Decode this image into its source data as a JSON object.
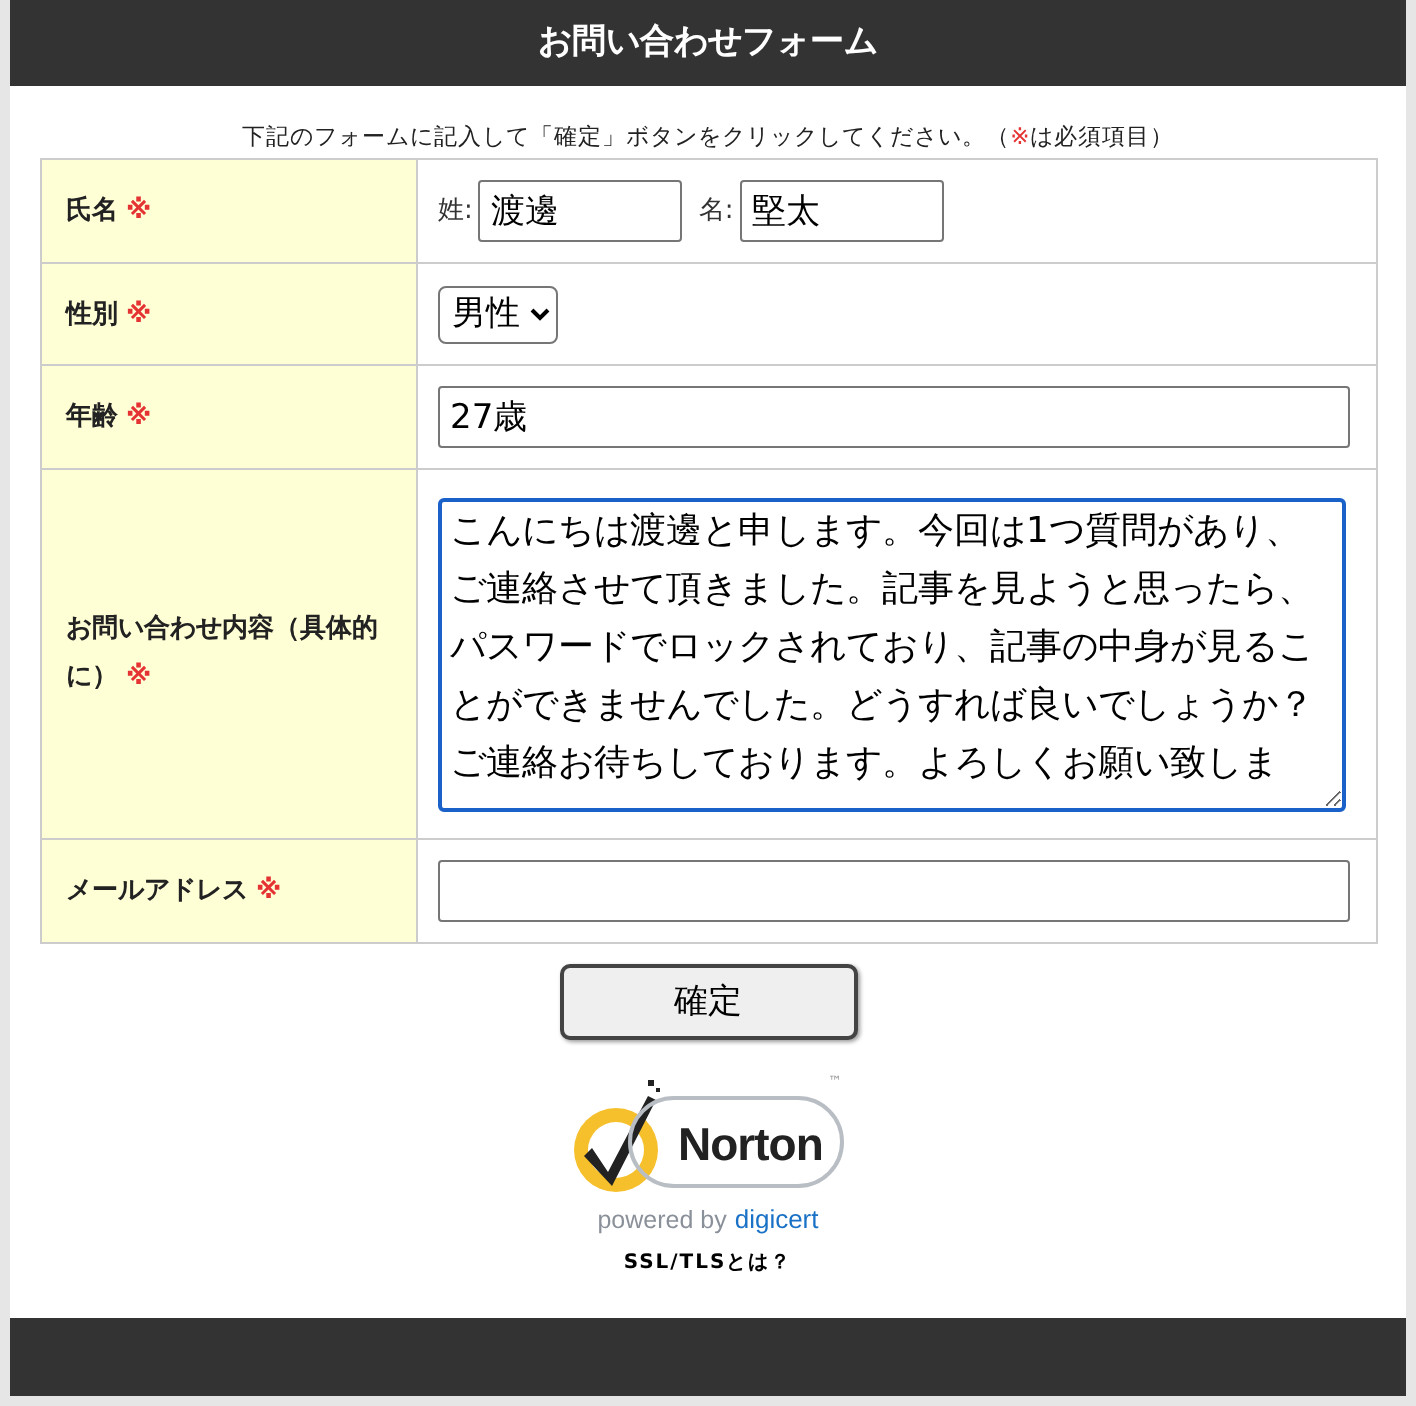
{
  "header": {
    "title": "お問い合わせフォーム"
  },
  "instruction": {
    "before": "下記のフォームに記入して「確定」ボタンをクリックしてください。（",
    "mark": "※",
    "after": "は必須項目）"
  },
  "rows": [
    {
      "kind": "name",
      "label": "氏名",
      "mark": "※",
      "last_label": "姓:",
      "last_value": "渡邊",
      "first_label": "名:",
      "first_value": "堅太"
    },
    {
      "kind": "select",
      "label": "性別",
      "mark": "※",
      "value": "男性"
    },
    {
      "kind": "text",
      "label": "年齢",
      "mark": "※",
      "value": "27歳"
    },
    {
      "kind": "textarea",
      "label": "お問い合わせ内容（具体的に）",
      "mark": "※",
      "focused": true,
      "value": "こんにちは渡邊と申します。今回は1つ質問があり、ご連絡させて頂きました。記事を見ようと思ったら、パスワードでロックされており、記事の中身が見ることができませんでした。どうすれば良いでしょうか？ご連絡お待ちしております。よろしくお願い致しま"
    },
    {
      "kind": "email",
      "label": "メールアドレス",
      "mark": "※",
      "value": ""
    }
  ],
  "submit": "確定",
  "seal": {
    "brand": "Norton",
    "trademark": "™",
    "tagline": "powered by",
    "partner": "digicert",
    "link": "SSL/TLSとは？"
  }
}
